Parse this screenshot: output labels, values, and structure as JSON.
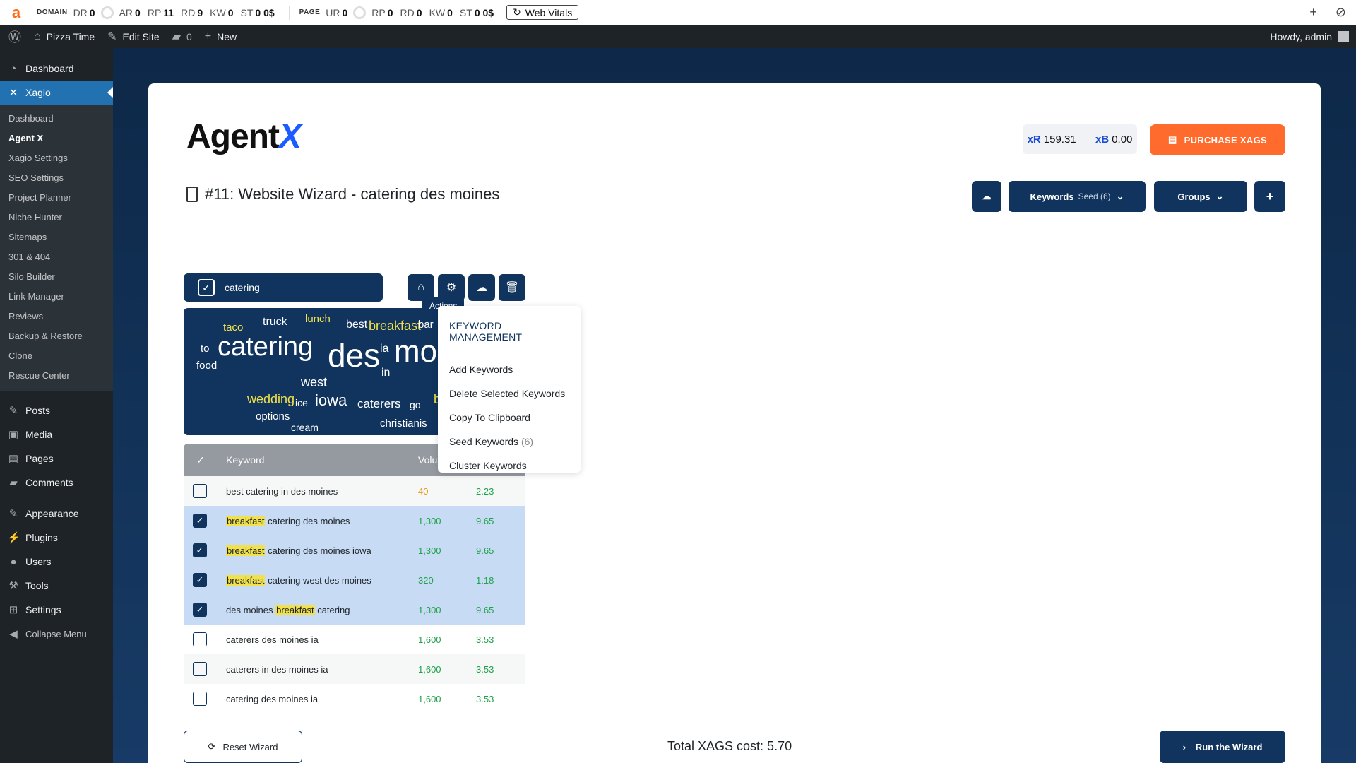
{
  "seo_bar": {
    "domain_label": "DOMAIN",
    "page_label": "PAGE",
    "domain_metrics": [
      {
        "label": "DR",
        "value": "0"
      },
      {
        "label": "AR",
        "value": "0"
      },
      {
        "label": "RP",
        "value": "11"
      },
      {
        "label": "RD",
        "value": "9"
      },
      {
        "label": "KW",
        "value": "0"
      },
      {
        "label": "ST",
        "value": "0 0$"
      }
    ],
    "page_metrics": [
      {
        "label": "UR",
        "value": "0"
      },
      {
        "label": "RP",
        "value": "0"
      },
      {
        "label": "RD",
        "value": "0"
      },
      {
        "label": "KW",
        "value": "0"
      },
      {
        "label": "ST",
        "value": "0 0$"
      }
    ],
    "web_vitals_label": "Web Vitals"
  },
  "admin_bar": {
    "site_name": "Pizza Time",
    "edit_site": "Edit Site",
    "comments_count": "0",
    "new_label": "New",
    "howdy": "Howdy, admin"
  },
  "sidebar": {
    "dashboard": "Dashboard",
    "xagio": "Xagio",
    "sub_items": [
      "Dashboard",
      "Agent X",
      "Xagio Settings",
      "SEO Settings",
      "Project Planner",
      "Niche Hunter",
      "Sitemaps",
      "301 & 404",
      "Silo Builder",
      "Link Manager",
      "Reviews",
      "Backup & Restore",
      "Clone",
      "Rescue Center"
    ],
    "posts": "Posts",
    "media": "Media",
    "pages": "Pages",
    "comments": "Comments",
    "appearance": "Appearance",
    "plugins": "Plugins",
    "users": "Users",
    "tools": "Tools",
    "settings": "Settings",
    "collapse": "Collapse Menu"
  },
  "header": {
    "logo_text": "Agent",
    "logo_x": "X",
    "xr_label": "xR",
    "xr_value": "159.31",
    "xb_label": "xB",
    "xb_value": "0.00",
    "purchase_label": "PURCHASE XAGS"
  },
  "project": {
    "title": "#11: Website Wizard - catering des moines",
    "keywords_btn": "Keywords",
    "keywords_seed": "Seed (6)",
    "groups_btn": "Groups",
    "add_btn": "+"
  },
  "group": {
    "name": "catering",
    "tooltip": "Actions"
  },
  "dropdown": {
    "header": "KEYWORD MANAGEMENT",
    "items": [
      "Add Keywords",
      "Delete Selected Keywords",
      "Copy To Clipboard",
      "Seed Keywords",
      "Cluster Keywords"
    ],
    "seed_count": "(6)"
  },
  "cloud_words": [
    {
      "t": "taco",
      "y": 1
    },
    {
      "t": "truck",
      "y": 0
    },
    {
      "t": "lunch",
      "y": 1
    },
    {
      "t": "best",
      "y": 0
    },
    {
      "t": "breakfast",
      "y": 1
    },
    {
      "t": "bar",
      "y": 0
    },
    {
      "t": "to",
      "y": 0
    },
    {
      "t": "catering",
      "y": 0
    },
    {
      "t": "des",
      "y": 0
    },
    {
      "t": "ia",
      "y": 0
    },
    {
      "t": "mo",
      "y": 0
    },
    {
      "t": "food",
      "y": 0
    },
    {
      "t": "in",
      "y": 0
    },
    {
      "t": "west",
      "y": 0
    },
    {
      "t": "wedding",
      "y": 1
    },
    {
      "t": "ice",
      "y": 0
    },
    {
      "t": "iowa",
      "y": 0
    },
    {
      "t": "caterers",
      "y": 0
    },
    {
      "t": "go",
      "y": 0
    },
    {
      "t": "b",
      "y": 1
    },
    {
      "t": "options",
      "y": 0
    },
    {
      "t": "cream",
      "y": 0
    },
    {
      "t": "christianis",
      "y": 0
    }
  ],
  "table": {
    "col_keyword": "Keyword",
    "col_volume": "Volu",
    "rows": [
      {
        "pre": "best catering in des moines",
        "hl": "",
        "post": "",
        "volume": "40",
        "cpc": "2.23",
        "checked": false,
        "orange": true
      },
      {
        "pre": "",
        "hl": "breakfast",
        "post": " catering des moines",
        "volume": "1,300",
        "cpc": "9.65",
        "checked": true,
        "orange": false
      },
      {
        "pre": "",
        "hl": "breakfast",
        "post": " catering des moines iowa",
        "volume": "1,300",
        "cpc": "9.65",
        "checked": true,
        "orange": false
      },
      {
        "pre": "",
        "hl": "breakfast",
        "post": " catering west des moines",
        "volume": "320",
        "cpc": "1.18",
        "checked": true,
        "orange": false
      },
      {
        "pre": "des moines ",
        "hl": "breakfast",
        "post": " catering",
        "volume": "1,300",
        "cpc": "9.65",
        "checked": true,
        "orange": false
      },
      {
        "pre": "caterers des moines ia",
        "hl": "",
        "post": "",
        "volume": "1,600",
        "cpc": "3.53",
        "checked": false,
        "orange": false
      },
      {
        "pre": "caterers in des moines ia",
        "hl": "",
        "post": "",
        "volume": "1,600",
        "cpc": "3.53",
        "checked": false,
        "orange": false
      },
      {
        "pre": "catering des moines ia",
        "hl": "",
        "post": "",
        "volume": "1,600",
        "cpc": "3.53",
        "checked": false,
        "orange": false
      }
    ]
  },
  "footer": {
    "reset_label": "Reset Wizard",
    "total_label": "Total XAGS cost: 5.70",
    "run_label": "Run the Wizard"
  },
  "colors": {
    "navy": "#10345e",
    "orange": "#ff6b2c",
    "wp_blue": "#2271b1",
    "highlight": "#f1e14c",
    "green": "#1fa34a"
  }
}
